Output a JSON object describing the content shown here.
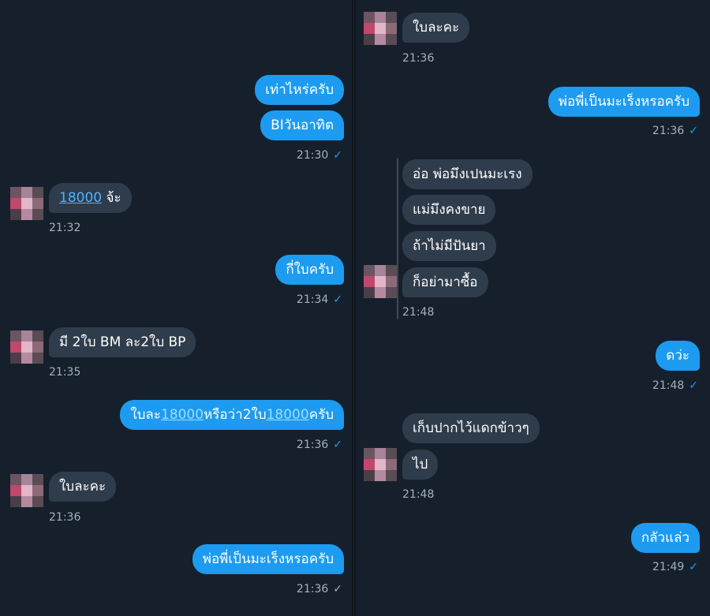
{
  "left": {
    "m1": "เท่าไหร่ครับ",
    "m2": "BIวันอาทิต",
    "m2_time": "21:30",
    "m3_link": "18000",
    "m3_rest": " จ้ะ",
    "m3_time": "21:32",
    "m4": "กี่ใบครับ",
    "m4_time": "21:34",
    "m5": "มี 2ใบ BM ละ2ใบ BP",
    "m5_time": "21:35",
    "m6_a": "ใบละ",
    "m6_b": "18000",
    "m6_c": "หรือว่า2ใบ",
    "m6_d": "18000",
    "m6_e": "ครับ",
    "m6_time": "21:36",
    "m7": "ใบละคะ",
    "m7_time": "21:36",
    "m8": "พ่อพี่เป็นมะเร็งหรอครับ",
    "m8_time": "21:36"
  },
  "right": {
    "r1": "ใบละคะ",
    "r1_time": "21:36",
    "r2": "พ่อพี่เป็นมะเร็งหรอครับ",
    "r2_time": "21:36",
    "r3": "อ่อ พ่อมึงเปนมะเรง",
    "r4": "แม่มึงคงขาย",
    "r5": "ถ้าไม่มีปันยา",
    "r6": "ก็อย่ามาซื้อ",
    "r6_time": "21:48",
    "r7": "ดว่ะ",
    "r7_time": "21:48",
    "r8": "เก็บปากไว้แดกข้าวๆ",
    "r9": "ไป",
    "r9_time": "21:48",
    "r10": "กลัวแล่ว",
    "r10_time": "21:49"
  },
  "icons": {
    "read_receipt": "✓"
  },
  "colors": {
    "background": "#16202c",
    "outgoing_bubble": "#1d9bf0",
    "incoming_bubble": "#2f3c4b",
    "timestamp": "#a3b1c0"
  }
}
